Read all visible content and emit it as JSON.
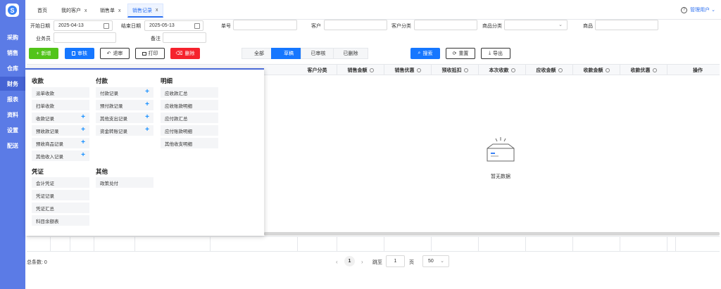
{
  "app": {
    "logo_letter": "S"
  },
  "sidebar": {
    "items": [
      {
        "label": "采购"
      },
      {
        "label": "销售"
      },
      {
        "label": "仓库"
      },
      {
        "label": "财务"
      },
      {
        "label": "报表"
      },
      {
        "label": "资料"
      },
      {
        "label": "设置"
      },
      {
        "label": "配送"
      }
    ],
    "active": "财务"
  },
  "tabs": [
    {
      "label": "首页",
      "closable": false
    },
    {
      "label": "我的客户",
      "closable": true
    },
    {
      "label": "销售单",
      "closable": true
    },
    {
      "label": "销售记录",
      "closable": true,
      "active": true
    }
  ],
  "tab_close": "x",
  "user": {
    "help_icon": "?",
    "name": "管理用户",
    "chevron": "⌄"
  },
  "filters": {
    "start_date_label": "开始日期",
    "start_date": "2025-04-13",
    "end_date_label": "结束日期",
    "end_date": "2025-05-13",
    "doc_no_label": "单号",
    "customer_label": "客户",
    "customer_cat_label": "客户分类",
    "product_cat_label": "商品分类",
    "product_label": "商品",
    "salesman_label": "业务员",
    "note_label": "备注"
  },
  "toolbar": {
    "add": "新增",
    "audit": "审核",
    "unaudit": "退审",
    "print": "打印",
    "delete": "删除",
    "add_icon": "+",
    "unaudit_icon": "↶",
    "delete_icon": "⌫"
  },
  "status_filter": [
    "全部",
    "草稿",
    "已审核",
    "已删除"
  ],
  "status_active": "草稿",
  "actions": {
    "search": "搜索",
    "reset": "重置",
    "export": "导出",
    "search_icon": "⌕",
    "reset_icon": "⟳",
    "export_icon": "⤓"
  },
  "table": {
    "columns": [
      "客户分类",
      "销售金额",
      "销售优惠",
      "预收抵扣",
      "本次收款",
      "应收金额",
      "收款金额",
      "收款优惠",
      "操作"
    ],
    "empty_text": "暂无数据"
  },
  "pagination": {
    "total_label": "总条数: 0",
    "prev": "‹",
    "next": "›",
    "current": "1",
    "goto_label": "跳至",
    "goto_value": "1",
    "page_unit": "页",
    "page_size": "50"
  },
  "menu": {
    "groups": [
      {
        "title": "收款",
        "items": [
          {
            "label": "派单收款",
            "plus": false
          },
          {
            "label": "扫单收款",
            "plus": false
          },
          {
            "label": "收款记录",
            "plus": true
          },
          {
            "label": "预收款记录",
            "plus": true
          },
          {
            "label": "预收商品记录",
            "plus": true
          },
          {
            "label": "其他收入记录",
            "plus": true
          }
        ]
      },
      {
        "title": "付款",
        "items": [
          {
            "label": "付款记录",
            "plus": true
          },
          {
            "label": "预付款记录",
            "plus": true
          },
          {
            "label": "其他支出记录",
            "plus": true
          },
          {
            "label": "资金转账记录",
            "plus": true
          }
        ]
      },
      {
        "title": "明细",
        "items": [
          {
            "label": "应收款汇总",
            "plus": false
          },
          {
            "label": "应收账款明细",
            "plus": false
          },
          {
            "label": "应付款汇总",
            "plus": false
          },
          {
            "label": "应付账款明细",
            "plus": false
          },
          {
            "label": "其他收支明细",
            "plus": false
          }
        ]
      },
      {
        "title": "凭证",
        "items": [
          {
            "label": "会计凭证",
            "plus": false
          },
          {
            "label": "凭证记录",
            "plus": false
          },
          {
            "label": "凭证汇总",
            "plus": false
          },
          {
            "label": "科目余额表",
            "plus": false
          }
        ]
      },
      {
        "title": "其他",
        "items": [
          {
            "label": "政策兑付",
            "plus": false
          }
        ]
      }
    ],
    "plus_symbol": "+"
  }
}
